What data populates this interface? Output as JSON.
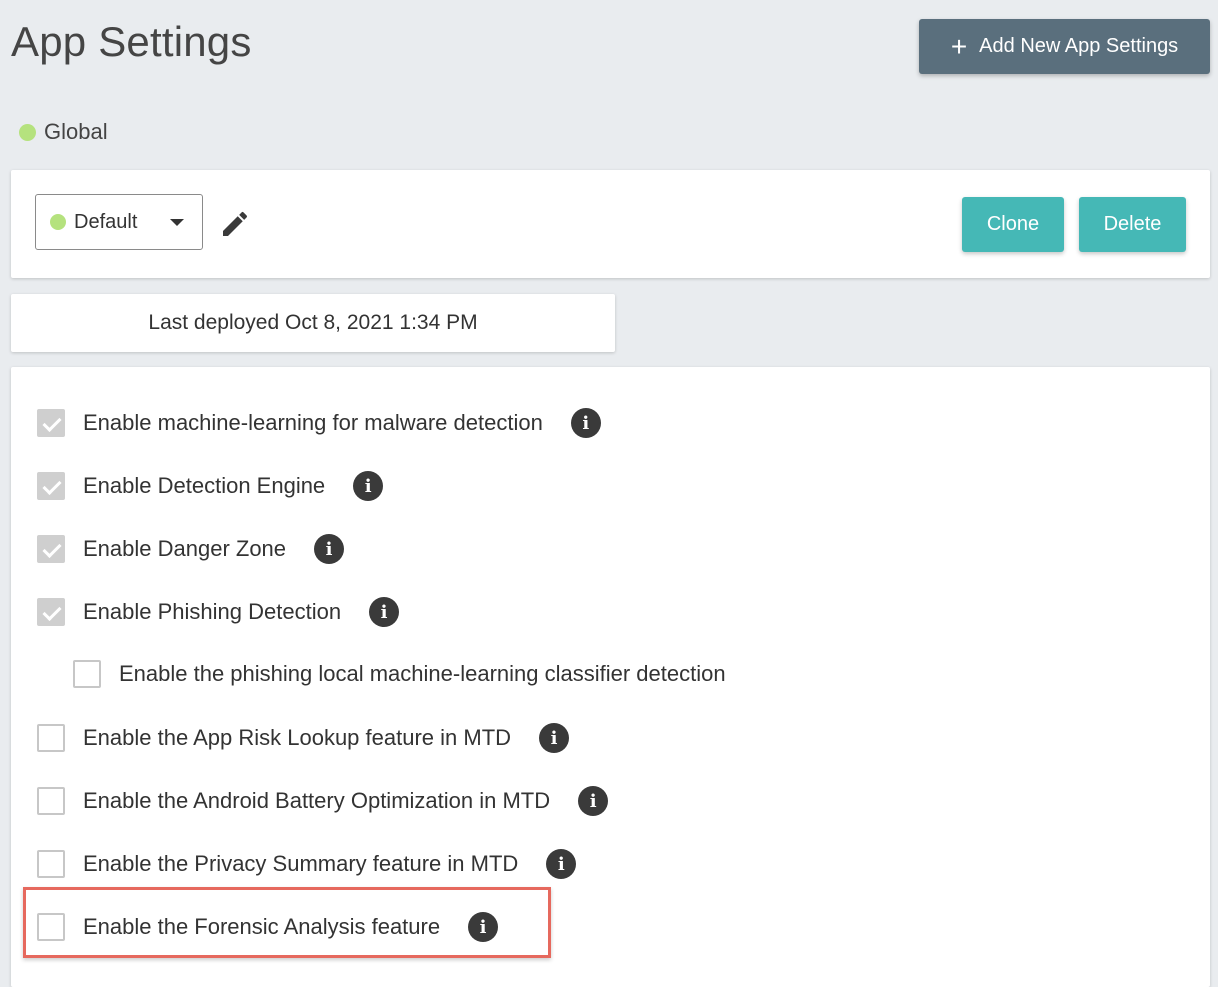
{
  "header": {
    "title": "App Settings",
    "add_button_label": "Add New App Settings"
  },
  "scope": {
    "label": "Global",
    "status_color": "#b5e27e"
  },
  "profile": {
    "selected": "Default",
    "clone_label": "Clone",
    "delete_label": "Delete"
  },
  "deploy": {
    "text": "Last deployed Oct 8, 2021 1:34 PM"
  },
  "options": [
    {
      "label": "Enable machine-learning for malware detection",
      "checked": true,
      "info": true
    },
    {
      "label": "Enable Detection Engine",
      "checked": true,
      "info": true
    },
    {
      "label": "Enable Danger Zone",
      "checked": true,
      "info": true
    },
    {
      "label": "Enable Phishing Detection",
      "checked": true,
      "info": true
    },
    {
      "label": "Enable the phishing local machine-learning classifier detection",
      "checked": false,
      "info": false
    },
    {
      "label": "Enable the App Risk Lookup feature in MTD",
      "checked": false,
      "info": true
    },
    {
      "label": "Enable the Android Battery Optimization in MTD",
      "checked": false,
      "info": true
    },
    {
      "label": "Enable the Privacy Summary feature in MTD",
      "checked": false,
      "info": true
    },
    {
      "label": "Enable the Forensic Analysis feature",
      "checked": false,
      "info": true
    }
  ],
  "colors": {
    "accent_teal": "#45b8b6",
    "header_button": "#5a6f7d",
    "highlight": "#e6695e"
  },
  "icons": {
    "info": "i",
    "plus": "+"
  }
}
